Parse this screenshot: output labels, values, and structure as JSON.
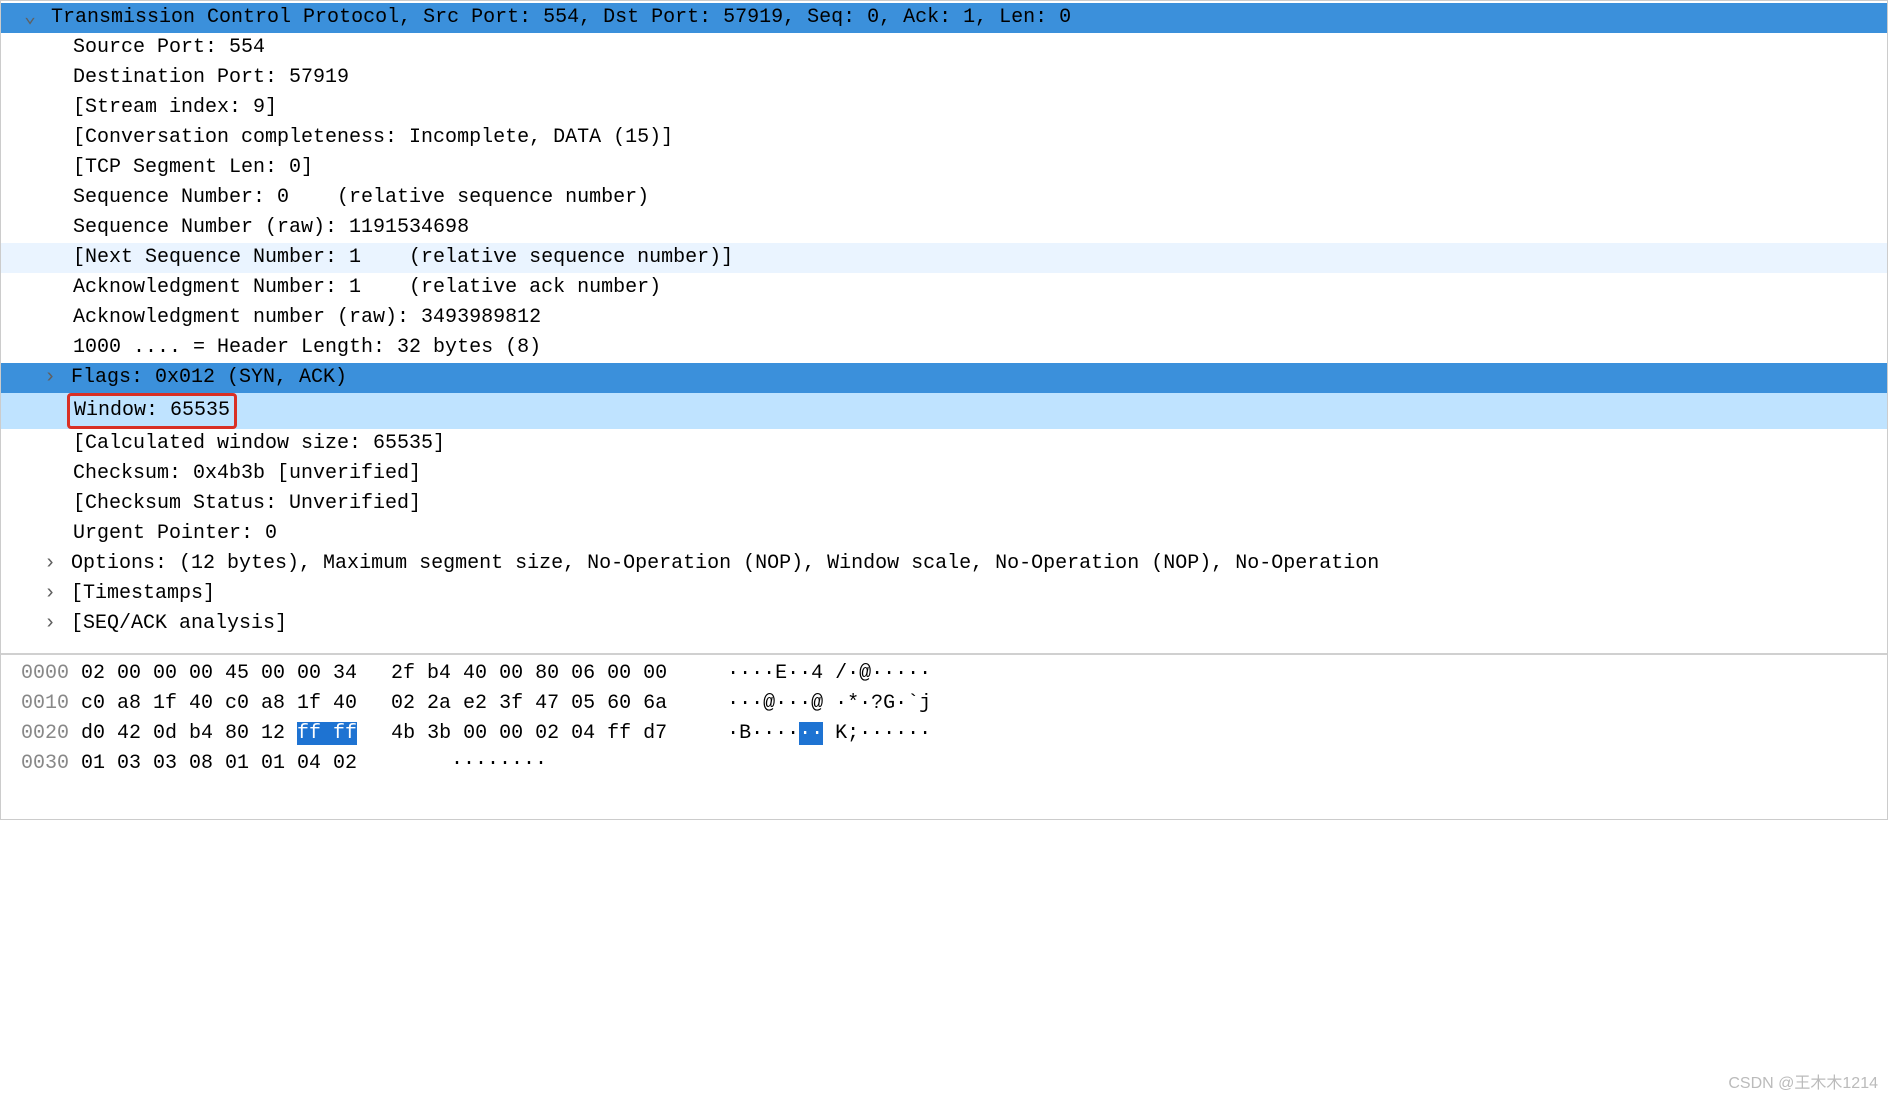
{
  "tcp": {
    "header": "Transmission Control Protocol, Src Port: 554, Dst Port: 57919, Seq: 0, Ack: 1, Len: 0",
    "src_port": "Source Port: 554",
    "dst_port": "Destination Port: 57919",
    "stream_index": "[Stream index: 9]",
    "conv_complete": "[Conversation completeness: Incomplete, DATA (15)]",
    "seg_len": "[TCP Segment Len: 0]",
    "seq_num": "Sequence Number: 0    (relative sequence number)",
    "seq_raw": "Sequence Number (raw): 1191534698",
    "next_seq": "[Next Sequence Number: 1    (relative sequence number)]",
    "ack_num": "Acknowledgment Number: 1    (relative ack number)",
    "ack_raw": "Acknowledgment number (raw): 3493989812",
    "hdr_len": "1000 .... = Header Length: 32 bytes (8)",
    "flags": "Flags: 0x012 (SYN, ACK)",
    "window": "Window: 65535",
    "calc_win": "[Calculated window size: 65535]",
    "checksum": "Checksum: 0x4b3b [unverified]",
    "cks_status": "[Checksum Status: Unverified]",
    "urg": "Urgent Pointer: 0",
    "options": "Options: (12 bytes), Maximum segment size, No-Operation (NOP), Window scale, No-Operation (NOP), No-Operation",
    "timestamps": "[Timestamps]",
    "seqack": "[SEQ/ACK analysis]"
  },
  "hex": {
    "r0": {
      "off": "0000",
      "a": "02 00 00 00 45 00 00 34",
      "b": "2f b4 40 00 80 06 00 00",
      "asc": "····E··4 /·@·····"
    },
    "r1": {
      "off": "0010",
      "a": "c0 a8 1f 40 c0 a8 1f 40",
      "b": "02 2a e2 3f 47 05 60 6a",
      "asc": "···@···@ ·*·?G·`j"
    },
    "r2": {
      "off": "0020",
      "a_pre": "d0 42 0d b4 80 12 ",
      "a_hl": "ff ff",
      "b": "4b 3b 00 00 02 04 ff d7",
      "asc_pre": "·B····",
      "asc_hl": "··",
      "asc_post": " K;······"
    },
    "r3": {
      "off": "0030",
      "a": "01 03 03 08 01 01 04 02",
      "b": "",
      "asc": "········"
    }
  },
  "watermark": "CSDN @王木木1214"
}
